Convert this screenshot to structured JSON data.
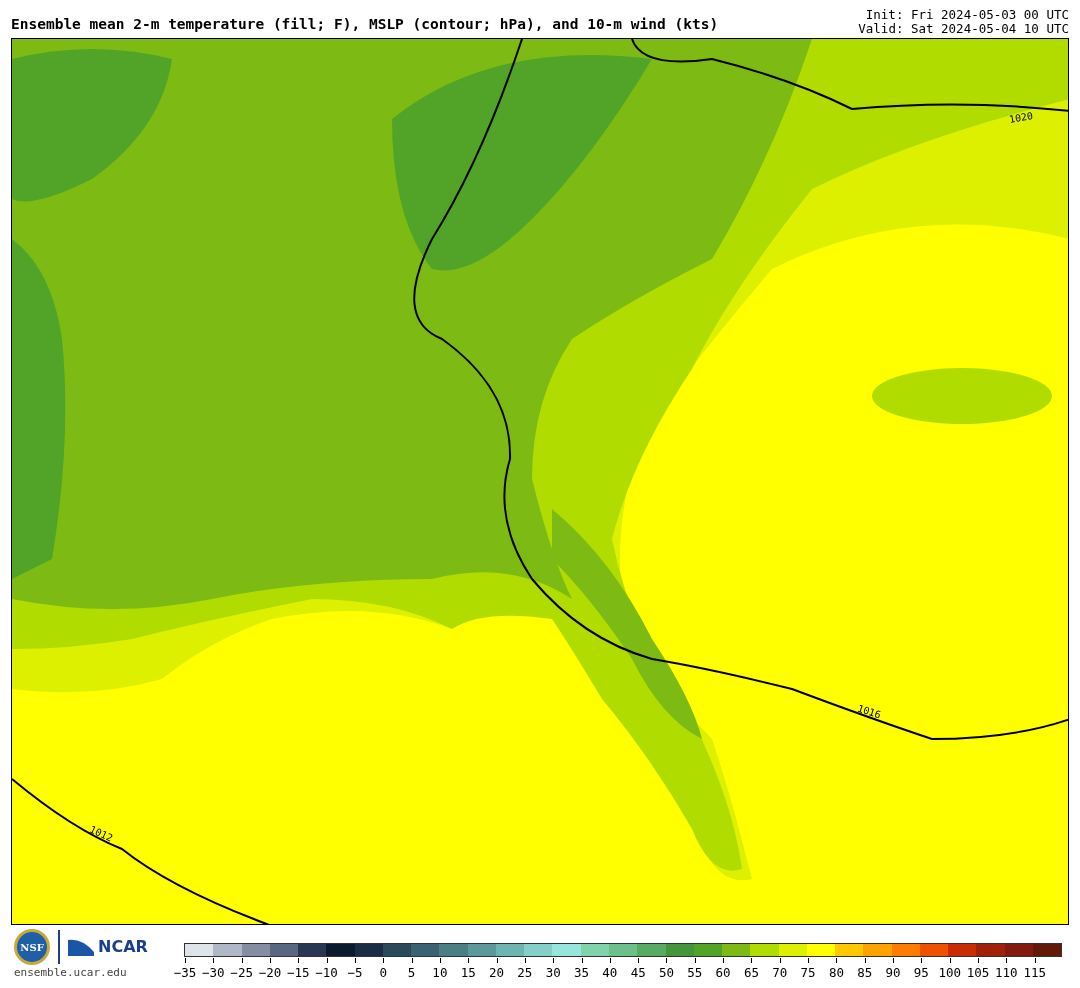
{
  "header": {
    "title": "Ensemble mean 2-m temperature (fill; F), MSLP (contour; hPa), and 10-m wind (kts)",
    "init": "Init: Fri 2024-05-03 00 UTC",
    "valid": "Valid: Sat 2024-05-04 10 UTC"
  },
  "map": {
    "contour_labels": [
      "1020",
      "1016",
      "1012"
    ]
  },
  "footer": {
    "nsf_seal": "NSF",
    "ncar_logo": "NCAR",
    "site": "ensemble.ucar.edu"
  },
  "colorbar": [
    {
      "label": "−35",
      "color": "#dfe3ea"
    },
    {
      "label": "−30",
      "color": "#b0b7c6"
    },
    {
      "label": "−25",
      "color": "#848ea2"
    },
    {
      "label": "−20",
      "color": "#5b6780"
    },
    {
      "label": "−15",
      "color": "#2b3652"
    },
    {
      "label": "−10",
      "color": "#0c1a30"
    },
    {
      "label": "−5",
      "color": "#1a2d45"
    },
    {
      "label": "0",
      "color": "#2a4a5c"
    },
    {
      "label": "5",
      "color": "#396272"
    },
    {
      "label": "10",
      "color": "#4a7f86"
    },
    {
      "label": "15",
      "color": "#5a9a9c"
    },
    {
      "label": "20",
      "color": "#6db5b0"
    },
    {
      "label": "25",
      "color": "#84cfc8"
    },
    {
      "label": "30",
      "color": "#97e6dc"
    },
    {
      "label": "35",
      "color": "#7fd4ac"
    },
    {
      "label": "40",
      "color": "#6cc08a"
    },
    {
      "label": "45",
      "color": "#58ac62"
    },
    {
      "label": "50",
      "color": "#43963a"
    },
    {
      "label": "55",
      "color": "#52a428"
    },
    {
      "label": "60",
      "color": "#7dbb14"
    },
    {
      "label": "65",
      "color": "#b0dc00"
    },
    {
      "label": "70",
      "color": "#dcf000"
    },
    {
      "label": "75",
      "color": "#ffff00"
    },
    {
      "label": "80",
      "color": "#ffc800"
    },
    {
      "label": "85",
      "color": "#ffa200"
    },
    {
      "label": "90",
      "color": "#ff7c00"
    },
    {
      "label": "95",
      "color": "#ee5200"
    },
    {
      "label": "100",
      "color": "#c82c00"
    },
    {
      "label": "105",
      "color": "#a32008"
    },
    {
      "label": "110",
      "color": "#841a0c"
    },
    {
      "label": "115",
      "color": "#641808"
    }
  ]
}
